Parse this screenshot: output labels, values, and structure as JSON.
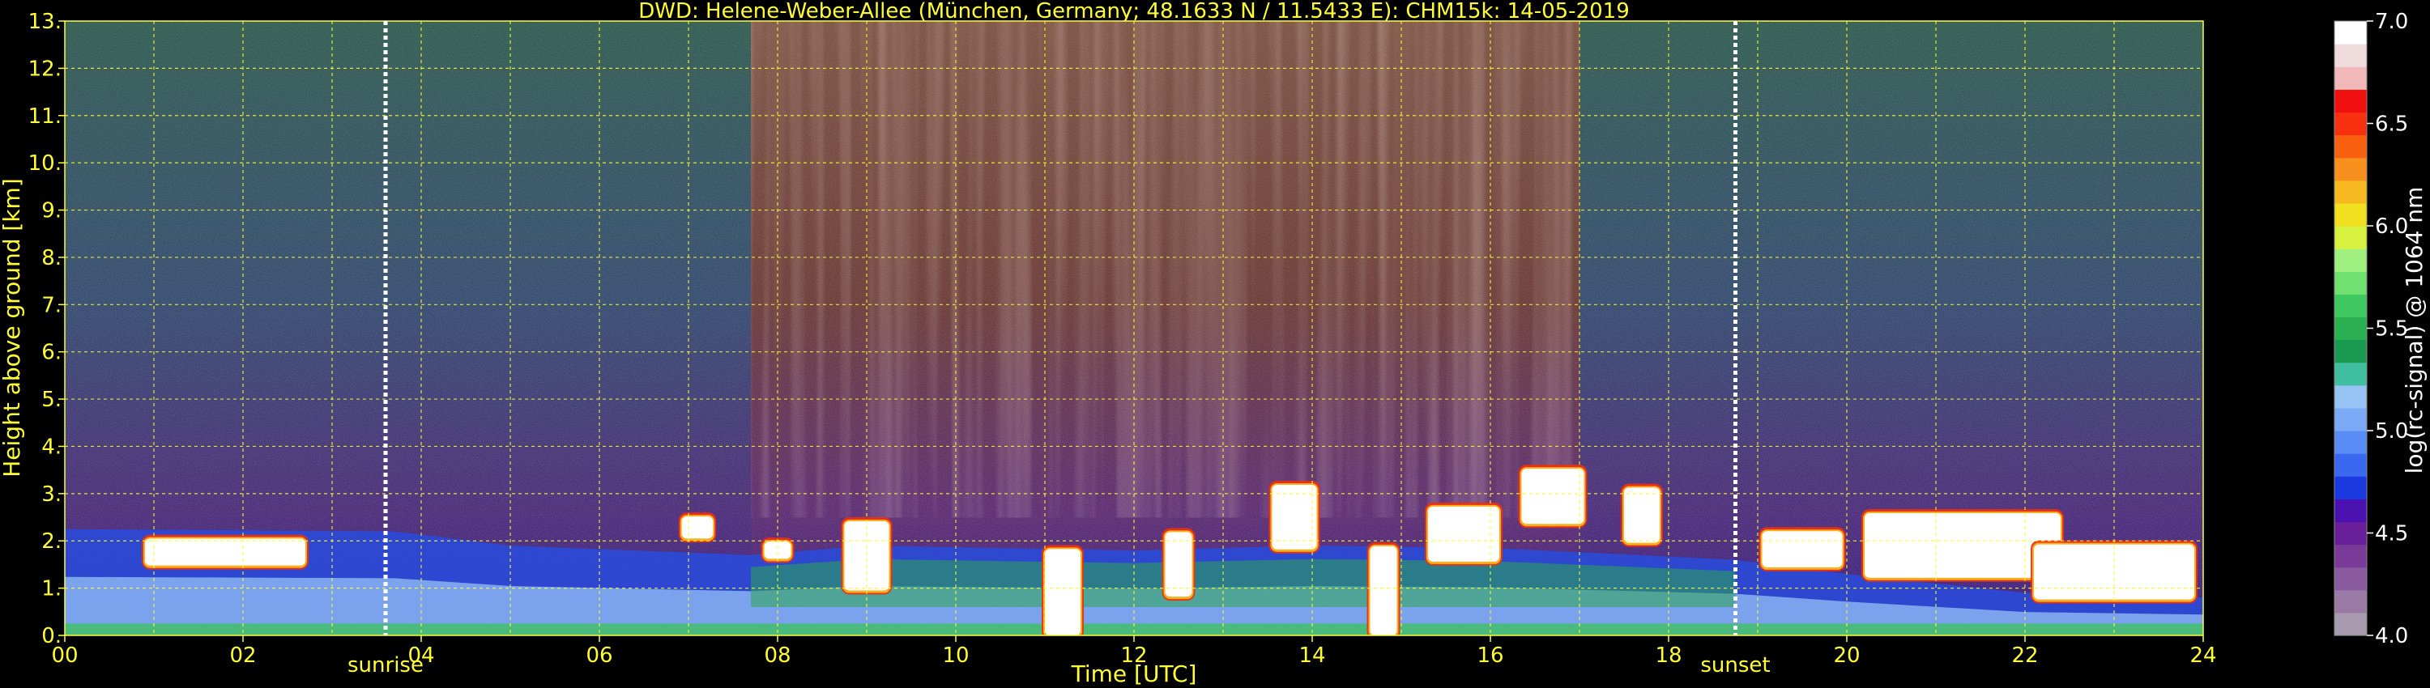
{
  "chart_data": {
    "type": "heatmap",
    "title": "DWD: Helene-Weber-Allee (München, Germany; 48.1633 N / 11.5433 E):    CHM15k: 14-05-2019",
    "xlabel": "Time [UTC]",
    "ylabel": "Height above ground [km]",
    "xlim": [
      0,
      24
    ],
    "ylim": [
      0,
      13
    ],
    "x_ticks": [
      "00",
      "02",
      "04",
      "06",
      "08",
      "10",
      "12",
      "14",
      "16",
      "18",
      "20",
      "22",
      "24"
    ],
    "y_ticks": [
      "0.",
      "1.",
      "2.",
      "3.",
      "4.",
      "5.",
      "6.",
      "7.",
      "8.",
      "9.",
      "10.",
      "11.",
      "12.",
      "13."
    ],
    "grid": true,
    "markers": [
      {
        "label": "sunrise",
        "time": 3.6
      },
      {
        "label": "sunset",
        "time": 18.75
      }
    ],
    "colorbar": {
      "label": "log(rc-signal) @ 1064 nm",
      "range": [
        4.0,
        7.0
      ],
      "ticks": [
        "4.0",
        "4.5",
        "5.0",
        "5.5",
        "6.0",
        "6.5",
        "7.0"
      ],
      "colors": [
        "#a89bb0",
        "#9b7ba6",
        "#8a5aa0",
        "#7a3a98",
        "#6a1f9a",
        "#4a10b0",
        "#1a3ae0",
        "#3a68f0",
        "#5a8cf5",
        "#7aaaf5",
        "#98c4f5",
        "#3fbfa0",
        "#1a9a50",
        "#2ab050",
        "#40c860",
        "#70e070",
        "#a0f080",
        "#d8f040",
        "#f0e020",
        "#f8b820",
        "#f89020",
        "#f86010",
        "#f83010",
        "#f01010",
        "#f0b8b8",
        "#f0dcdc",
        "#ffffff"
      ]
    },
    "background_layers": [
      {
        "time_range": [
          0.0,
          7.7
        ],
        "top_color": "#2f5a4f",
        "mid_color": "#324a6e",
        "low_color": "#4a2a78"
      },
      {
        "time_range": [
          7.7,
          17.0
        ],
        "top_color": "#7a5040",
        "mid_color": "#6a3a35",
        "low_color": "#5a2a70"
      },
      {
        "time_range": [
          17.0,
          24.0
        ],
        "top_color": "#2f5a4f",
        "mid_color": "#324a6e",
        "low_color": "#4a2a78"
      }
    ],
    "boundary_layer_top_km": [
      {
        "time": 0.0,
        "height": 2.25
      },
      {
        "time": 3.7,
        "height": 2.2
      },
      {
        "time": 5.0,
        "height": 1.9
      },
      {
        "time": 7.7,
        "height": 1.7
      },
      {
        "time": 9.0,
        "height": 1.9
      },
      {
        "time": 12.0,
        "height": 1.8
      },
      {
        "time": 14.0,
        "height": 1.9
      },
      {
        "time": 16.0,
        "height": 1.85
      },
      {
        "time": 18.75,
        "height": 1.6
      },
      {
        "time": 20.0,
        "height": 1.3
      },
      {
        "time": 22.0,
        "height": 0.9
      },
      {
        "time": 24.0,
        "height": 0.8
      }
    ],
    "clouds": [
      {
        "time": 1.8,
        "height": 1.9,
        "width": 1.8,
        "depth": 0.6
      },
      {
        "time": 7.1,
        "height": 2.4,
        "width": 0.35,
        "depth": 0.5
      },
      {
        "time": 8.0,
        "height": 1.9,
        "width": 0.3,
        "depth": 0.4
      },
      {
        "time": 9.0,
        "height": 2.0,
        "width": 0.5,
        "depth": 1.5
      },
      {
        "time": 11.2,
        "height": 1.2,
        "width": 0.4,
        "depth": 2.2
      },
      {
        "time": 12.5,
        "height": 1.8,
        "width": 0.3,
        "depth": 1.4
      },
      {
        "time": 13.8,
        "height": 2.8,
        "width": 0.5,
        "depth": 1.4
      },
      {
        "time": 14.8,
        "height": 1.2,
        "width": 0.3,
        "depth": 2.4
      },
      {
        "time": 15.7,
        "height": 2.4,
        "width": 0.8,
        "depth": 1.2
      },
      {
        "time": 16.7,
        "height": 3.2,
        "width": 0.7,
        "depth": 1.2
      },
      {
        "time": 17.7,
        "height": 2.8,
        "width": 0.4,
        "depth": 1.2
      },
      {
        "time": 19.5,
        "height": 2.0,
        "width": 0.9,
        "depth": 0.8
      },
      {
        "time": 21.3,
        "height": 2.2,
        "width": 2.2,
        "depth": 1.4
      },
      {
        "time": 23.0,
        "height": 1.6,
        "width": 1.8,
        "depth": 1.2
      }
    ]
  }
}
